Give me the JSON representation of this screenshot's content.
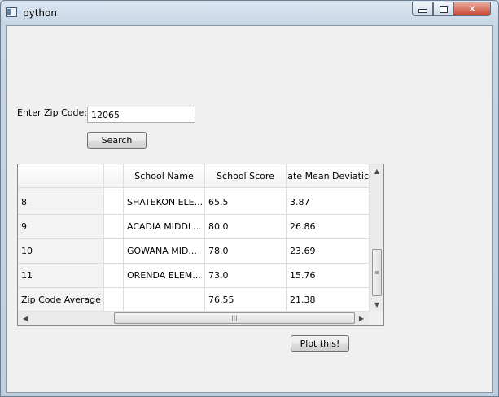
{
  "window": {
    "title": "python",
    "icons": {
      "app": "python-window-icon",
      "minimize": "minimize-icon",
      "maximize": "maximize-icon",
      "close": "close-icon"
    },
    "close_glyph": "✕"
  },
  "form": {
    "zip_label": "Enter Zip Code:",
    "zip_value": "12065",
    "search_label": "Search",
    "plot_label": "Plot this!"
  },
  "table": {
    "columns": [
      "",
      "",
      "School Name",
      "School Score",
      "ate Mean Deviatic"
    ],
    "rows": [
      {
        "idx": "8",
        "name": "SHATEKON ELE...",
        "score": "65.5",
        "dev": "3.87"
      },
      {
        "idx": "9",
        "name": "ACADIA MIDDL...",
        "score": "80.0",
        "dev": "26.86"
      },
      {
        "idx": "10",
        "name": "GOWANA MID...",
        "score": "78.0",
        "dev": "23.69"
      },
      {
        "idx": "11",
        "name": "ORENDA ELEM...",
        "score": "73.0",
        "dev": "15.76"
      },
      {
        "idx": "Zip Code Average",
        "name": "",
        "score": "76.55",
        "dev": "21.38"
      }
    ],
    "scroll": {
      "up": "▲",
      "down": "▼",
      "left": "◀",
      "right": "▶",
      "vertical_position": 0.9,
      "horizontal_position": 0.5
    }
  }
}
